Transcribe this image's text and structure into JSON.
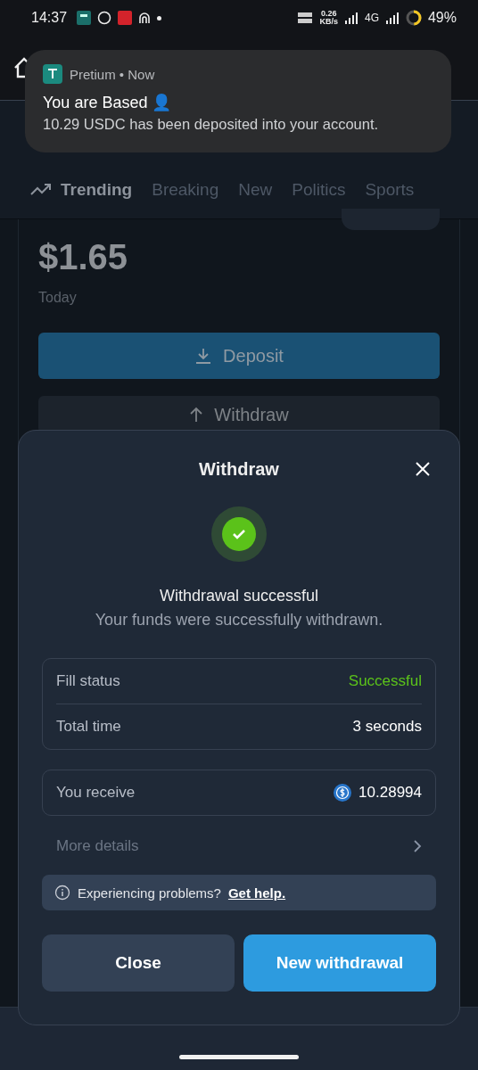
{
  "status_bar": {
    "time": "14:37",
    "speed": [
      "0.26",
      "KB/s"
    ],
    "network": "4G",
    "battery": "49%"
  },
  "notification": {
    "source": "Pretium • Now",
    "title": "You are Based 👤",
    "body": "10.29 USDC has been deposited into your account."
  },
  "tabs": [
    {
      "label": "Trending",
      "selected": true
    },
    {
      "label": "Breaking",
      "selected": false
    },
    {
      "label": "New",
      "selected": false
    },
    {
      "label": "Politics",
      "selected": false
    },
    {
      "label": "Sports",
      "selected": false
    }
  ],
  "portfolio": {
    "value": "$1.65",
    "period": "Today",
    "deposit": "Deposit",
    "withdraw": "Withdraw"
  },
  "modal": {
    "title": "Withdraw",
    "heading": "Withdrawal successful",
    "subtitle": "Your funds were successfully withdrawn.",
    "details": [
      {
        "label": "Fill status",
        "value": "Successful",
        "kind": "success"
      },
      {
        "label": "Total time",
        "value": "3 seconds",
        "kind": "plain"
      }
    ],
    "receive": {
      "label": "You receive",
      "value": "10.28994"
    },
    "more": "More details",
    "help": {
      "text": "Experiencing problems?",
      "link": "Get help."
    },
    "buttons": [
      {
        "label": "Close",
        "kind": "secondary"
      },
      {
        "label": "New withdrawal",
        "kind": "primary"
      }
    ]
  }
}
